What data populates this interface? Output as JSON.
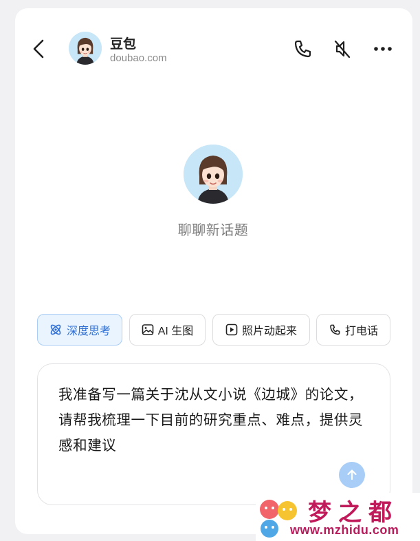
{
  "header": {
    "title": "豆包",
    "subtitle": "doubao.com"
  },
  "main": {
    "prompt_label": "聊聊新话题"
  },
  "chips": [
    {
      "label": "深度思考",
      "icon": "atom-icon",
      "active": true
    },
    {
      "label": "AI 生图",
      "icon": "image-icon",
      "active": false
    },
    {
      "label": "照片动起来",
      "icon": "play-icon",
      "active": false
    },
    {
      "label": "打电话",
      "icon": "phone-icon",
      "active": false
    }
  ],
  "input": {
    "value": "我准备写一篇关于沈从文小说《边城》的论文，请帮我梳理一下目前的研究重点、难点，提供灵感和建议"
  },
  "watermark": {
    "title": "梦之都",
    "url": "www.mzhidu.com"
  },
  "colors": {
    "accent": "#2f6fd4",
    "chip_active_bg": "#eaf4ff",
    "send_button": "#a8cdf7",
    "watermark": "#c11a5a"
  }
}
